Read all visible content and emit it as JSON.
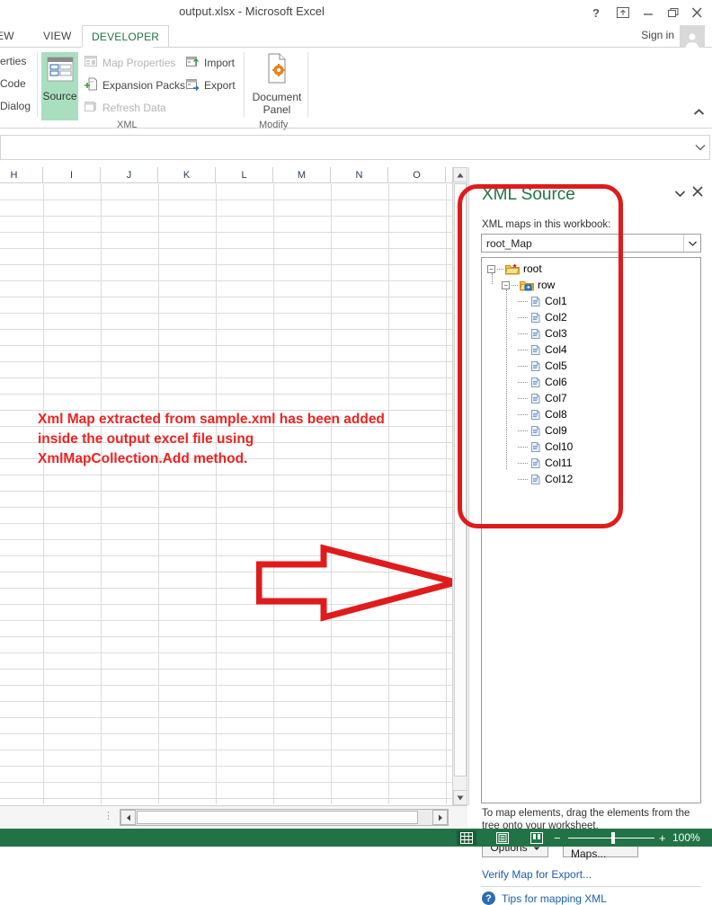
{
  "window": {
    "title": "output.xlsx - Microsoft Excel",
    "help_icon": "question-mark-icon",
    "ribbon_display_icon": "ribbon-display-options-icon",
    "minimize_icon": "minimize-icon",
    "restore_icon": "restore-icon",
    "close_icon": "close-icon",
    "signin": "Sign in",
    "avatar": "user-avatar-icon"
  },
  "tabs": [
    {
      "label": "EW",
      "active": false
    },
    {
      "label": "VIEW",
      "active": false
    },
    {
      "label": "DEVELOPER",
      "active": true
    }
  ],
  "ribbon": {
    "left_commands": [
      "erties",
      "Code",
      "Dialog"
    ],
    "source_button": {
      "label": "Source",
      "icon": "xml-source-icon",
      "selected": true
    },
    "xml_commands": [
      {
        "label": "Map Properties",
        "icon": "map-properties-icon",
        "enabled": false
      },
      {
        "label": "Expansion Packs",
        "icon": "expansion-packs-icon",
        "enabled": true
      },
      {
        "label": "Refresh Data",
        "icon": "refresh-data-icon",
        "enabled": false
      },
      {
        "label": "Import",
        "icon": "import-icon",
        "enabled": true
      },
      {
        "label": "Export",
        "icon": "export-icon",
        "enabled": true
      }
    ],
    "document_panel": {
      "label_line1": "Document",
      "label_line2": "Panel",
      "icon": "document-panel-icon"
    },
    "group_labels": {
      "xml": "XML",
      "modify": "Modify"
    },
    "collapse_icon": "collapse-ribbon-icon"
  },
  "formula_bar": {
    "value": "",
    "expand_icon": "chevron-down-icon"
  },
  "sheet": {
    "column_headers": [
      "H",
      "I",
      "J",
      "K",
      "L",
      "M",
      "N",
      "O"
    ],
    "annotation": "Xml Map extracted from sample.xml has been added inside the output excel file using XmlMapCollection.Add method.",
    "annotation_color": "#ee2222",
    "arrow_shape": "right-arrow-annotation",
    "arrow_color": "#e01b1b",
    "highlight_rect_color": "#e01b1b"
  },
  "scrollbars": {
    "vertical_up_icon": "scroll-up-icon",
    "vertical_down_icon": "scroll-down-icon",
    "horizontal_left_icon": "scroll-left-icon",
    "horizontal_right_icon": "scroll-right-icon",
    "sheet_tab_grip": "⋮"
  },
  "task_pane": {
    "title": "XML Source",
    "collapse_icon": "task-pane-menu-icon",
    "close_icon": "close-icon",
    "maps_label": "XML maps in this workbook:",
    "selected_map": "root_Map",
    "dropdown_icon": "chevron-down-icon",
    "tree": [
      {
        "label": "root",
        "depth": 0,
        "icon": "folder-new-icon",
        "expander": "minus"
      },
      {
        "label": "row",
        "depth": 1,
        "icon": "folder-repeat-icon",
        "expander": "minus"
      },
      {
        "label": "Col1",
        "depth": 2,
        "icon": "xml-element-icon",
        "expander": "none"
      },
      {
        "label": "Col2",
        "depth": 2,
        "icon": "xml-element-icon",
        "expander": "none"
      },
      {
        "label": "Col3",
        "depth": 2,
        "icon": "xml-element-icon",
        "expander": "none"
      },
      {
        "label": "Col4",
        "depth": 2,
        "icon": "xml-element-icon",
        "expander": "none"
      },
      {
        "label": "Col5",
        "depth": 2,
        "icon": "xml-element-icon",
        "expander": "none"
      },
      {
        "label": "Col6",
        "depth": 2,
        "icon": "xml-element-icon",
        "expander": "none"
      },
      {
        "label": "Col7",
        "depth": 2,
        "icon": "xml-element-icon",
        "expander": "none"
      },
      {
        "label": "Col8",
        "depth": 2,
        "icon": "xml-element-icon",
        "expander": "none"
      },
      {
        "label": "Col9",
        "depth": 2,
        "icon": "xml-element-icon",
        "expander": "none"
      },
      {
        "label": "Col10",
        "depth": 2,
        "icon": "xml-element-icon",
        "expander": "none"
      },
      {
        "label": "Col11",
        "depth": 2,
        "icon": "xml-element-icon",
        "expander": "none"
      },
      {
        "label": "Col12",
        "depth": 2,
        "icon": "xml-element-icon",
        "expander": "none"
      }
    ],
    "help_text": "To map elements, drag the elements from the tree onto your worksheet.",
    "options_button": "Options",
    "options_dropdown_icon": "chevron-down-icon",
    "xml_maps_button": "XML Maps...",
    "verify_link": "Verify Map for Export...",
    "tips_link": "Tips for mapping XML",
    "tips_icon": "help-circle-icon"
  },
  "status_bar": {
    "view_normal_icon": "normal-view-icon",
    "view_pagelayout_icon": "page-layout-view-icon",
    "view_pagebreak_icon": "page-break-preview-icon",
    "zoom_out_icon": "minus-icon",
    "zoom_in_icon": "plus-icon",
    "zoom_value": "100%",
    "accent_color": "#217346"
  }
}
